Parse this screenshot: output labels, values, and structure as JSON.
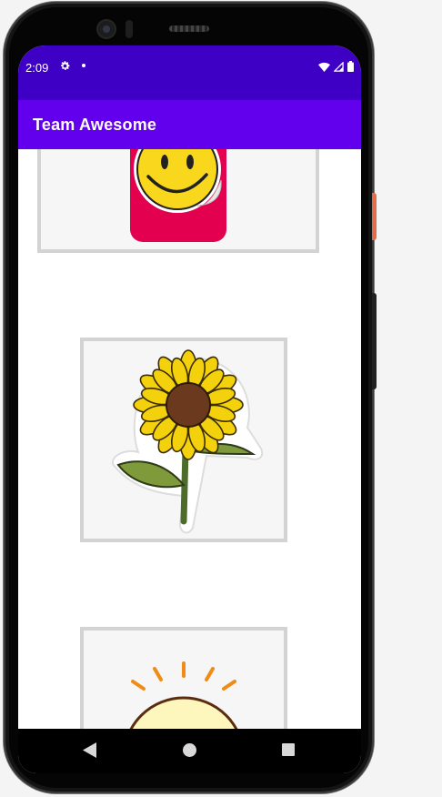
{
  "status_bar": {
    "time": "2:09",
    "icons": [
      "gear-icon",
      "notification-dot-icon",
      "wifi-icon",
      "cellular-icon",
      "battery-icon"
    ],
    "color": "#3f00c6"
  },
  "app_bar": {
    "title": "Team Awesome",
    "color": "#6200ee"
  },
  "sticker_list": {
    "items": [
      {
        "image": "smiley-sticker-image"
      },
      {
        "image": "sunflower-sticker-image"
      },
      {
        "image": "sun-sticker-image"
      }
    ]
  },
  "nav_bar": {
    "buttons": [
      "back-icon",
      "home-icon",
      "recents-icon"
    ]
  }
}
